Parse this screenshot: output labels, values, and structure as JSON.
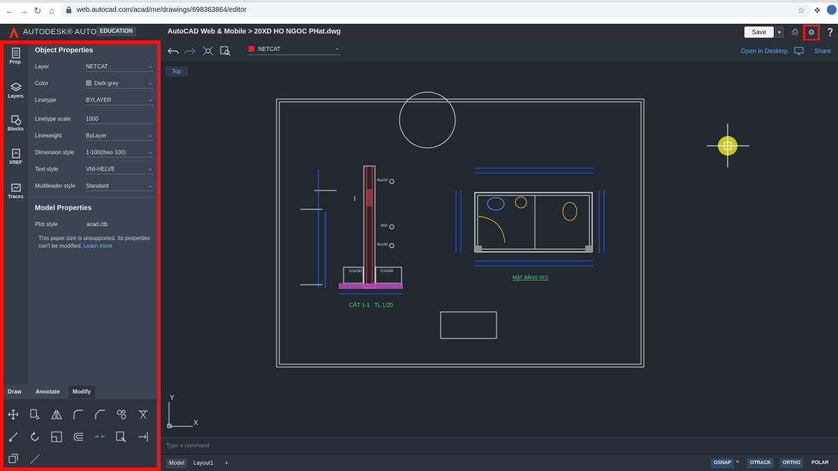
{
  "browser": {
    "url": "web.autocad.com/acad/me/drawings/698363864/editor"
  },
  "header": {
    "brand": "AUTODESK® AUTOCAD®",
    "edition_badge": "EDUCATION",
    "breadcrumb": "AutoCAD Web & Mobile  >  20XD HO NGOC PHat.dwg",
    "save_label": "Save"
  },
  "rail": [
    {
      "label": "Prop.",
      "icon": "properties-icon"
    },
    {
      "label": "Layers",
      "icon": "layers-icon"
    },
    {
      "label": "Blocks",
      "icon": "blocks-icon"
    },
    {
      "label": "XREF",
      "icon": "xref-icon"
    },
    {
      "label": "Traces",
      "icon": "traces-icon"
    }
  ],
  "object_properties": {
    "title": "Object Properties",
    "rows": [
      {
        "label": "Layer",
        "value": "NETCAT",
        "dropdown": true
      },
      {
        "label": "Color",
        "value": "Dark grey",
        "dropdown": true,
        "swatch": "#8a8a8a"
      },
      {
        "label": "Linetype",
        "value": "BYLAYER",
        "dropdown": true
      },
      {
        "label": "Linetype scale",
        "value": "1000",
        "dropdown": false
      },
      {
        "label": "Lineweight",
        "value": "ByLayer",
        "dropdown": true
      },
      {
        "label": "Dimension style",
        "value": "1-100(theo 100)",
        "dropdown": true
      },
      {
        "label": "Text style",
        "value": "VNI-HELVE",
        "dropdown": true
      },
      {
        "label": "Multileader style",
        "value": "Standard",
        "dropdown": true
      }
    ]
  },
  "model_properties": {
    "title": "Model Properties",
    "plot_style_label": "Plot style",
    "plot_style_value": "acad.ctb",
    "note": "This paper size is unsupported. Its properties can't be modified.",
    "learn_more": "Learn more"
  },
  "tool_tabs": [
    "Draw",
    "Annotate",
    "Modify"
  ],
  "toolbar": {
    "layer_value": "NETCAT",
    "layer_color": "#ff1a1a",
    "open_desktop": "Open in Desktop",
    "share": "Share"
  },
  "canvas": {
    "view_label": "Top",
    "section_title": "CẮT 1-1 : TL 1/20",
    "plan_title": "MẶT BẰNG W.C",
    "axis_x": "X",
    "axis_y": "Y",
    "annot_1": "f6a102",
    "annot_2": "4f16",
    "annot_3": "f6a150",
    "annot_4": "f12a150",
    "annot_5": "f12a100"
  },
  "command": {
    "placeholder": "Type a command"
  },
  "status": {
    "tabs": [
      "Model",
      "Layout1"
    ],
    "add": "+",
    "buttons": [
      "OSNAP",
      "OTRACK",
      "ORTHO",
      "POLAR"
    ]
  },
  "colors": {
    "highlight": "#ff1010",
    "accent": "#5aa9f0"
  }
}
